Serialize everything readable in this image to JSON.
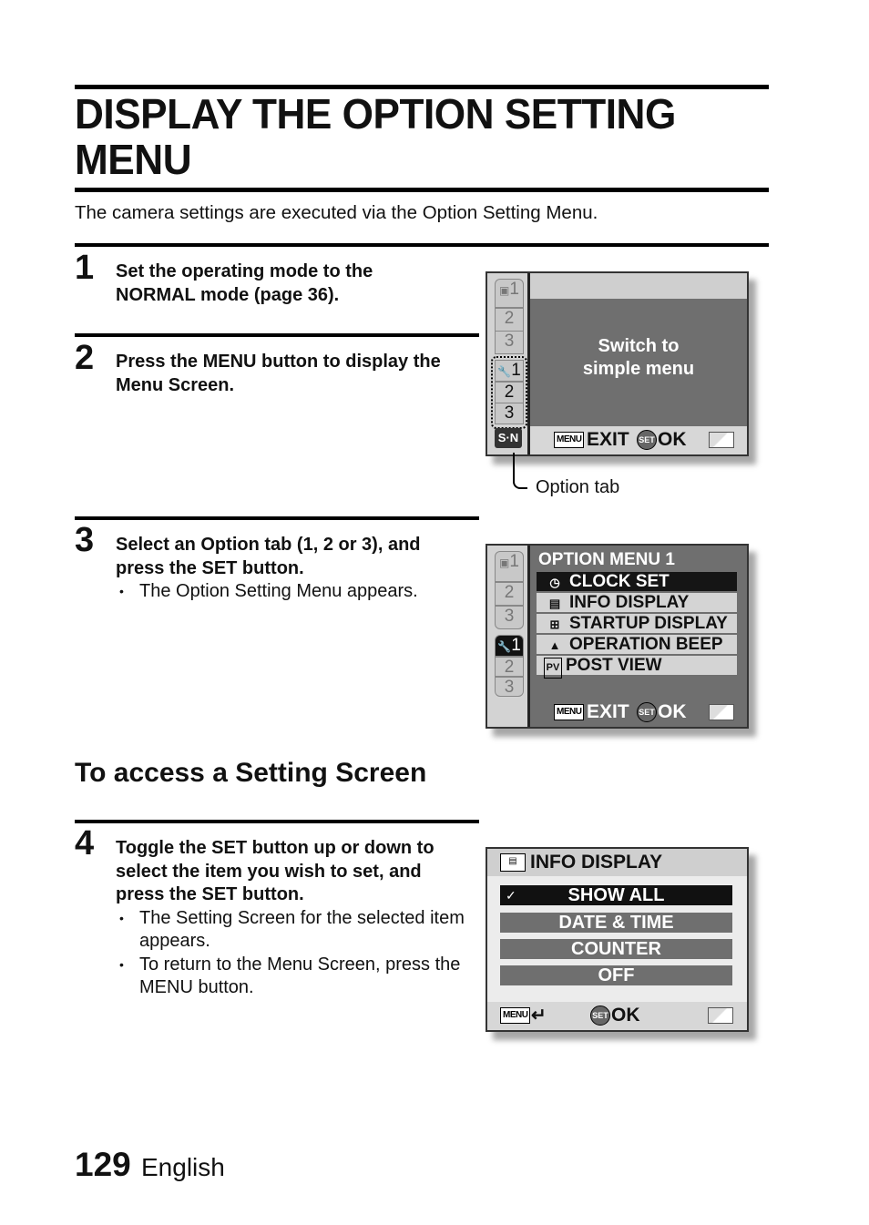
{
  "page": {
    "title": "DISPLAY THE OPTION SETTING MENU",
    "intro": "The camera settings are executed via the Option Setting Menu.",
    "subheading": "To access a Setting Screen",
    "page_number": "129",
    "language": "English"
  },
  "steps": [
    {
      "number": "1",
      "text": "Set the operating mode to the NORMAL mode (page 36).",
      "bullets": []
    },
    {
      "number": "2",
      "text": "Press the MENU button to display the Menu Screen.",
      "bullets": []
    },
    {
      "number": "3",
      "text": "Select an Option tab (1, 2 or 3), and press the SET button.",
      "bullets": [
        "The Option Setting Menu appears."
      ]
    },
    {
      "number": "4",
      "text": "Toggle the SET button up or down to select the item you wish to set, and press the SET button.",
      "bullets": [
        "The Setting Screen for the selected item appears.",
        "To return to the Menu Screen, press the MENU button."
      ]
    }
  ],
  "screen1": {
    "tabs": [
      "1",
      "2",
      "3",
      "1",
      "2",
      "3"
    ],
    "mode_badge": "S·N",
    "message_line1": "Switch to",
    "message_line2": "simple menu",
    "menu_glyph": "MENU",
    "exit_label": "EXIT",
    "set_glyph": "SET",
    "ok_label": "OK",
    "callout": "Option tab"
  },
  "screen2": {
    "tabs": [
      "1",
      "2",
      "3",
      "1",
      "2",
      "3"
    ],
    "header": "OPTION MENU 1",
    "items": [
      {
        "icon": "clock-icon",
        "glyph": "◷",
        "label": "CLOCK SET",
        "selected": true
      },
      {
        "icon": "info-display-icon",
        "glyph": "▤",
        "label": "INFO DISPLAY",
        "selected": false
      },
      {
        "icon": "startup-display-icon",
        "glyph": "⊞",
        "label": "STARTUP DISPLAY",
        "selected": false
      },
      {
        "icon": "bell-icon",
        "glyph": "▲",
        "label": "OPERATION BEEP",
        "selected": false
      },
      {
        "icon": "post-view-icon",
        "glyph": "PV",
        "label": "POST VIEW",
        "selected": false
      }
    ],
    "menu_glyph": "MENU",
    "exit_label": "EXIT",
    "set_glyph": "SET",
    "ok_label": "OK"
  },
  "screen3": {
    "header": "INFO DISPLAY",
    "options": [
      {
        "label": "SHOW ALL",
        "selected": true,
        "check": "✓"
      },
      {
        "label": "DATE & TIME",
        "selected": false
      },
      {
        "label": "COUNTER",
        "selected": false
      },
      {
        "label": "OFF",
        "selected": false
      }
    ],
    "menu_glyph": "MENU",
    "return_glyph": "↵",
    "set_glyph": "SET",
    "ok_label": "OK"
  }
}
